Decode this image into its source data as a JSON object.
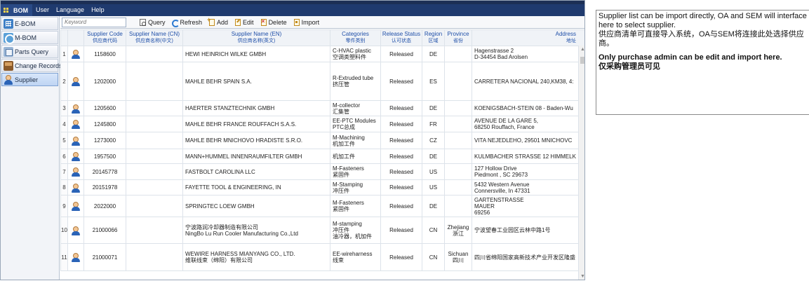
{
  "menu": {
    "logo": "BOM",
    "items": [
      "User",
      "Language",
      "Help"
    ]
  },
  "sidebar": {
    "items": [
      {
        "label": "E-BOM",
        "icon": "ebom-icon"
      },
      {
        "label": "M-BOM",
        "icon": "mbom-icon"
      },
      {
        "label": "Parts Query",
        "icon": "parts-query-icon"
      },
      {
        "label": "Change Records",
        "icon": "change-records-icon"
      },
      {
        "label": "Supplier",
        "icon": "supplier-icon",
        "active": true
      }
    ]
  },
  "toolbar": {
    "search_placeholder": "Keyword",
    "query_label": "Query",
    "refresh_label": "Refresh",
    "add_label": "Add",
    "edit_label": "Edit",
    "delete_label": "Delete",
    "import_label": "Import"
  },
  "table": {
    "columns": [
      {
        "en": "Supplier Code",
        "cn": "供应商代码"
      },
      {
        "en": "Supplier Name (CN)",
        "cn": "供应商名称(中文)"
      },
      {
        "en": "Supplier Name (EN)",
        "cn": "供应商名称(英文)"
      },
      {
        "en": "Categories",
        "cn": "零件类别"
      },
      {
        "en": "Release Status",
        "cn": "认可状态"
      },
      {
        "en": "Region",
        "cn": "区域"
      },
      {
        "en": "Province",
        "cn": "省份"
      },
      {
        "en": "Address",
        "cn": "地址"
      }
    ],
    "rows": [
      {
        "no": "1",
        "code": "1158600",
        "name_cn": "",
        "name_en": "HEWI HEINRICH WILKE GMBH",
        "categories": [
          "C-HVAC plastic",
          "空调类塑料件"
        ],
        "status": "Released",
        "region": "DE",
        "province": [],
        "address": [
          "Hagenstrasse 2",
          "D-34454 Bad Arolsen"
        ]
      },
      {
        "no": "2",
        "code": "1202000",
        "name_cn": "",
        "name_en": "MAHLE BEHR SPAIN S.A.",
        "categories": [
          "R-Extruded tube",
          "挤压管"
        ],
        "status": "Released",
        "region": "ES",
        "province": [],
        "address": [
          "CARRETERA NACIONAL 240,KM38, 4:"
        ]
      },
      {
        "no": "3",
        "code": "1205600",
        "name_cn": "",
        "name_en": "HAERTER STANZTECHNIK GMBH",
        "categories": [
          "M-collector",
          "汇集管"
        ],
        "status": "Released",
        "region": "DE",
        "province": [],
        "address": [
          "KOENIGSBACH-STEIN 08 - Baden-Wu"
        ]
      },
      {
        "no": "4",
        "code": "1245800",
        "name_cn": "",
        "name_en": "MAHLE BEHR FRANCE ROUFFACH S.A.S.",
        "categories": [
          "EE-PTC Modules",
          "PTC总成"
        ],
        "status": "Released",
        "region": "FR",
        "province": [],
        "address": [
          "AVENUE DE LA GARE 5,",
          "68250 Rouffach, France"
        ]
      },
      {
        "no": "5",
        "code": "1273000",
        "name_cn": "",
        "name_en": "MAHLE BEHR MNICHOVO HRADISTE S.R.O.",
        "categories": [
          "M-Machining",
          "机加工件"
        ],
        "status": "Released",
        "region": "CZ",
        "province": [],
        "address": [
          "VITA NEJEDLEHO, 29501 MNICHOVC"
        ]
      },
      {
        "no": "6",
        "code": "1957500",
        "name_cn": "",
        "name_en": "MANN+HUMMEL INNENRAUMFILTER GMBH",
        "categories": [
          "机加工件"
        ],
        "status": "Released",
        "region": "DE",
        "province": [],
        "address": [
          "KULMBACHER STRASSE 12 HIMMELK"
        ]
      },
      {
        "no": "7",
        "code": "20145778",
        "name_cn": "",
        "name_en": "FASTBOLT CAROLINA LLC",
        "categories": [
          "M-Fasteners",
          "紧固件"
        ],
        "status": "Released",
        "region": "US",
        "province": [],
        "address": [
          "127 Hollow Drive",
          "Piedmont , SC  29673"
        ]
      },
      {
        "no": "8",
        "code": "20151978",
        "name_cn": "",
        "name_en": "FAYETTE TOOL & ENGINEERING, IN",
        "categories": [
          "M-Stamping",
          "冲压件"
        ],
        "status": "Released",
        "region": "US",
        "province": [],
        "address": [
          "5432 Western Avenue",
          "Connersville, In 47331"
        ]
      },
      {
        "no": "9",
        "code": "2022000",
        "name_cn": "",
        "name_en": "SPRINGTEC LOEW GMBH",
        "categories": [
          "M-Fasteners",
          "紧固件"
        ],
        "status": "Released",
        "region": "DE",
        "province": [],
        "address": [
          "GARTENSTRASSE",
          "MAUER",
          "69256"
        ]
      },
      {
        "no": "10",
        "code": "21000066",
        "name_cn": "",
        "name_en": [
          "宁波路润冷却器制造有限公司",
          "NingBo Lu Run Cooler Manufacturing Co.,Ltd"
        ],
        "categories": [
          "M-stamping",
          "冲压件",
          "油冷器，机加件"
        ],
        "status": "Released",
        "region": "CN",
        "province": [
          "Zhejiang",
          "浙江"
        ],
        "address": [
          "宁波望春工业园区云林中路1号"
        ]
      },
      {
        "no": "11",
        "code": "21000071",
        "name_cn": "",
        "name_en": [
          "WEWIRE HARNESS MIANYANG CO., LTD.",
          "维联线束（绵阳）有限公司"
        ],
        "categories": [
          "EE-wireharness",
          "线束"
        ],
        "status": "Released",
        "region": "CN",
        "province": [
          "Sichuan",
          "四川"
        ],
        "address": [
          "四川省绵阳国家高新技术产业开发区隆盛"
        ]
      }
    ]
  },
  "note": {
    "line1": "Supplier list can be import directly, OA and SEM will interface here to select supplier.",
    "line2": "供应商清单可直接导入系统，OA与SEM将连接此处选择供应商。",
    "line3": "Only purchase admin can be edit and import here.",
    "line4": "仅采购管理员可见"
  }
}
